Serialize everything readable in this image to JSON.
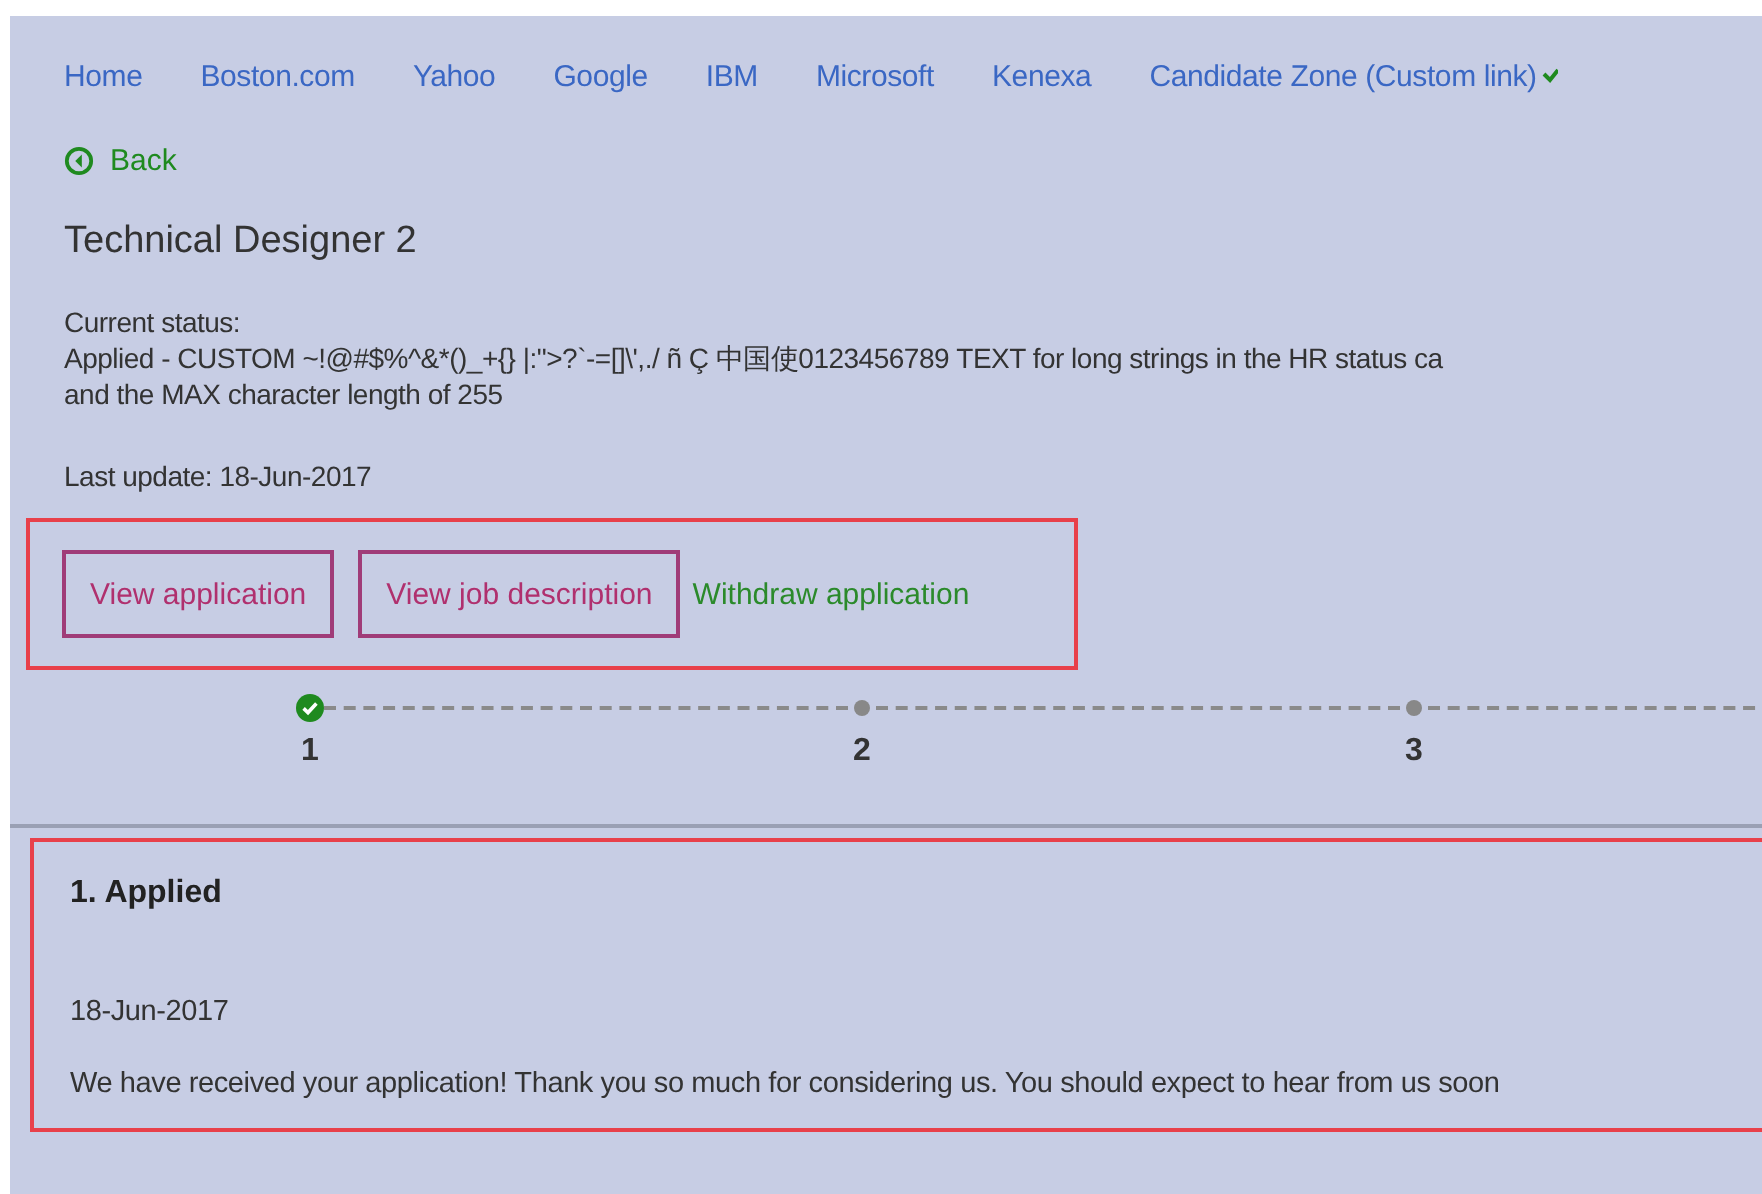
{
  "nav": {
    "links": [
      "Home",
      "Boston.com",
      "Yahoo",
      "Google",
      "IBM",
      "Microsoft",
      "Kenexa",
      "Candidate Zone (Custom link)"
    ]
  },
  "back": {
    "label": "Back"
  },
  "job": {
    "title": "Technical Designer 2"
  },
  "status": {
    "label": "Current status:",
    "lines": [
      "Applied - CUSTOM ~!@#$%^&*()_+{} |:\">?`-=[]\\',./ ñ Ç 中国使0123456789 TEXT for long strings in the HR status ca",
      "and the MAX character length of 255"
    ],
    "last_update": "Last update: 18-Jun-2017"
  },
  "actions": [
    {
      "label": "View application",
      "kind": "button"
    },
    {
      "label": "View job description",
      "kind": "button"
    },
    {
      "label": "Withdraw application",
      "kind": "link"
    }
  ],
  "steps": [
    {
      "number": "1",
      "done": true
    },
    {
      "number": "2",
      "done": false
    },
    {
      "number": "3",
      "done": false
    }
  ],
  "detail": {
    "title": "1. Applied",
    "date": "18-Jun-2017",
    "message": "We have received your application! Thank you so much for considering us. You should expect to hear from us soon"
  }
}
